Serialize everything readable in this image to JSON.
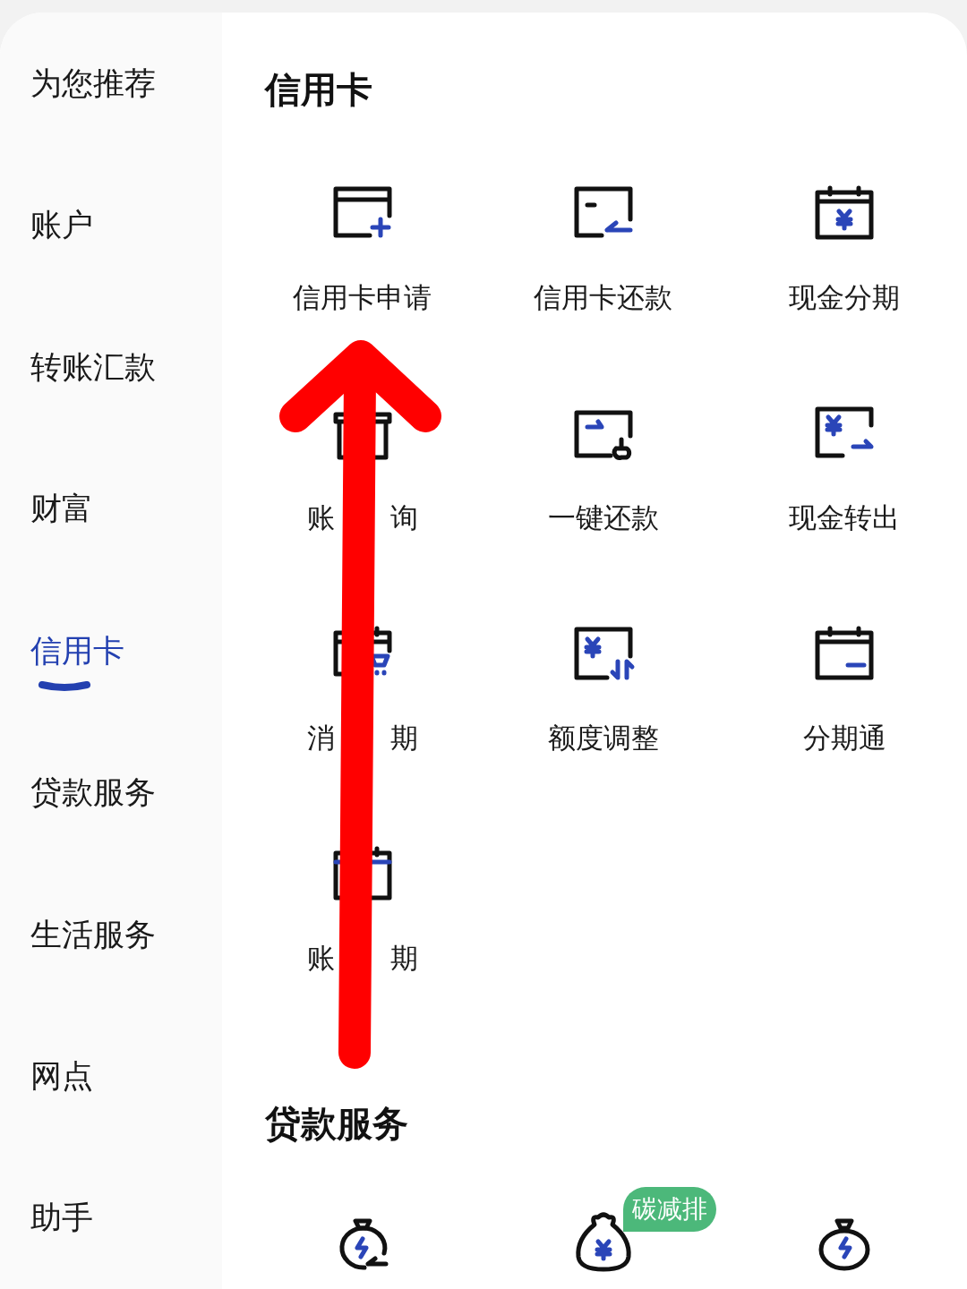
{
  "sidebar": {
    "items": [
      {
        "label": "为您推荐",
        "selected": false
      },
      {
        "label": "账户",
        "selected": false
      },
      {
        "label": "转账汇款",
        "selected": false
      },
      {
        "label": "财富",
        "selected": false
      },
      {
        "label": "信用卡",
        "selected": true
      },
      {
        "label": "贷款服务",
        "selected": false
      },
      {
        "label": "生活服务",
        "selected": false
      },
      {
        "label": "网点",
        "selected": false
      },
      {
        "label": "助手",
        "selected": false
      }
    ]
  },
  "credit_card": {
    "title": "信用卡",
    "items": [
      {
        "label": "信用卡申请"
      },
      {
        "label": "信用卡还款"
      },
      {
        "label": "现金分期"
      },
      {
        "label_parts": [
          "账",
          "询"
        ]
      },
      {
        "label": "一键还款"
      },
      {
        "label": "现金转出"
      },
      {
        "label_parts": [
          "消",
          "期"
        ]
      },
      {
        "label": "额度调整"
      },
      {
        "label": "分期通"
      },
      {
        "label_parts": [
          "账",
          "期"
        ]
      }
    ]
  },
  "loan_services": {
    "title": "贷款服务",
    "items": [
      {
        "kind": "plain"
      },
      {
        "kind": "badged",
        "badge": "碳减排"
      },
      {
        "kind": "plain"
      }
    ]
  }
}
